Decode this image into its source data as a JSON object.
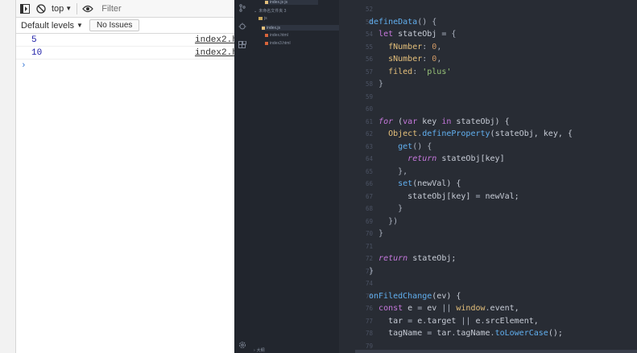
{
  "console": {
    "toolbar": {
      "context_label": "top",
      "filter_placeholder": "Filter"
    },
    "levels_label": "Default levels",
    "issues_label": "No Issues",
    "messages": [
      {
        "value": "5",
        "source": "index2.ht"
      },
      {
        "value": "10",
        "source": "index2.ht"
      }
    ],
    "prompt_symbol": "›"
  },
  "explorer": {
    "items": [
      {
        "label": "index.js  js"
      },
      {
        "label": "未命名文件夹 3"
      },
      {
        "label": "js"
      },
      {
        "label": "index.js"
      },
      {
        "label": "index.html"
      },
      {
        "label": "index3.html"
      }
    ],
    "outline_label": "大纲"
  },
  "editor": {
    "lines": [
      {
        "n": "52",
        "tokens": [
          [
            "plain",
            ""
          ]
        ]
      },
      {
        "n": "53",
        "tokens": [
          [
            "fn",
            "defineData"
          ],
          [
            "punct",
            "() {"
          ]
        ]
      },
      {
        "n": "54",
        "tokens": [
          [
            "plain",
            "  "
          ],
          [
            "kw",
            "let"
          ],
          [
            "plain",
            " stateObj "
          ],
          [
            "punct",
            "= {"
          ]
        ]
      },
      {
        "n": "55",
        "tokens": [
          [
            "plain",
            "    "
          ],
          [
            "prop",
            "fNumber"
          ],
          [
            "punct",
            ": "
          ],
          [
            "num",
            "0"
          ],
          [
            "punct",
            ","
          ]
        ]
      },
      {
        "n": "56",
        "tokens": [
          [
            "plain",
            "    "
          ],
          [
            "prop",
            "sNumber"
          ],
          [
            "punct",
            ": "
          ],
          [
            "num",
            "0"
          ],
          [
            "punct",
            ","
          ]
        ]
      },
      {
        "n": "57",
        "tokens": [
          [
            "plain",
            "    "
          ],
          [
            "prop",
            "filed"
          ],
          [
            "punct",
            ": "
          ],
          [
            "str",
            "'plus'"
          ]
        ]
      },
      {
        "n": "58",
        "tokens": [
          [
            "plain",
            "  "
          ],
          [
            "punct",
            "}"
          ]
        ]
      },
      {
        "n": "59",
        "tokens": [
          [
            "plain",
            ""
          ]
        ]
      },
      {
        "n": "60",
        "tokens": [
          [
            "plain",
            ""
          ]
        ]
      },
      {
        "n": "61",
        "tokens": [
          [
            "plain",
            "  "
          ],
          [
            "kwi",
            "for"
          ],
          [
            "plain",
            " ("
          ],
          [
            "kw",
            "var"
          ],
          [
            "plain",
            " key "
          ],
          [
            "kw",
            "in"
          ],
          [
            "plain",
            " stateObj) {"
          ]
        ]
      },
      {
        "n": "62",
        "tokens": [
          [
            "plain",
            "    "
          ],
          [
            "obj",
            "Object"
          ],
          [
            "punct",
            "."
          ],
          [
            "fn",
            "defineProperty"
          ],
          [
            "plain",
            "(stateObj, key, {"
          ]
        ]
      },
      {
        "n": "63",
        "tokens": [
          [
            "plain",
            "      "
          ],
          [
            "fn",
            "get"
          ],
          [
            "punct",
            "() {"
          ]
        ]
      },
      {
        "n": "64",
        "tokens": [
          [
            "plain",
            "        "
          ],
          [
            "kwi",
            "return"
          ],
          [
            "plain",
            " stateObj[key]"
          ]
        ]
      },
      {
        "n": "65",
        "tokens": [
          [
            "plain",
            "      "
          ],
          [
            "punct",
            "},"
          ]
        ]
      },
      {
        "n": "66",
        "tokens": [
          [
            "plain",
            "      "
          ],
          [
            "fn",
            "set"
          ],
          [
            "plain",
            "(newVal) {"
          ]
        ]
      },
      {
        "n": "67",
        "tokens": [
          [
            "plain",
            "        stateObj[key] "
          ],
          [
            "punct",
            "= "
          ],
          [
            "plain",
            "newVal;"
          ]
        ]
      },
      {
        "n": "68",
        "tokens": [
          [
            "plain",
            "      "
          ],
          [
            "punct",
            "}"
          ]
        ]
      },
      {
        "n": "69",
        "tokens": [
          [
            "plain",
            "    "
          ],
          [
            "punct",
            "})"
          ]
        ]
      },
      {
        "n": "70",
        "tokens": [
          [
            "plain",
            "  "
          ],
          [
            "punct",
            "}"
          ]
        ]
      },
      {
        "n": "71",
        "tokens": [
          [
            "plain",
            ""
          ]
        ]
      },
      {
        "n": "72",
        "tokens": [
          [
            "plain",
            "  "
          ],
          [
            "kwi",
            "return"
          ],
          [
            "plain",
            " stateObj;"
          ]
        ]
      },
      {
        "n": "73",
        "tokens": [
          [
            "punct",
            "}"
          ]
        ]
      },
      {
        "n": "74",
        "tokens": [
          [
            "plain",
            ""
          ]
        ]
      },
      {
        "n": "75",
        "tokens": [
          [
            "fn",
            "onFiledChange"
          ],
          [
            "plain",
            "(ev) {"
          ]
        ]
      },
      {
        "n": "76",
        "tokens": [
          [
            "plain",
            "  "
          ],
          [
            "kw",
            "const"
          ],
          [
            "plain",
            " e "
          ],
          [
            "punct",
            "= "
          ],
          [
            "plain",
            "ev "
          ],
          [
            "punct",
            "|| "
          ],
          [
            "obj",
            "window"
          ],
          [
            "punct",
            "."
          ],
          [
            "plain",
            "event,"
          ]
        ]
      },
      {
        "n": "77",
        "tokens": [
          [
            "plain",
            "    tar "
          ],
          [
            "punct",
            "= "
          ],
          [
            "plain",
            "e"
          ],
          [
            "punct",
            "."
          ],
          [
            "plain",
            "target "
          ],
          [
            "punct",
            "|| "
          ],
          [
            "plain",
            "e"
          ],
          [
            "punct",
            "."
          ],
          [
            "plain",
            "srcElement,"
          ]
        ]
      },
      {
        "n": "78",
        "tokens": [
          [
            "plain",
            "    tagName "
          ],
          [
            "punct",
            "= "
          ],
          [
            "plain",
            "tar"
          ],
          [
            "punct",
            "."
          ],
          [
            "plain",
            "tagName"
          ],
          [
            "punct",
            "."
          ],
          [
            "fn",
            "toLowerCase"
          ],
          [
            "plain",
            "();"
          ]
        ]
      },
      {
        "n": "79",
        "tokens": [
          [
            "plain",
            ""
          ]
        ]
      }
    ]
  }
}
